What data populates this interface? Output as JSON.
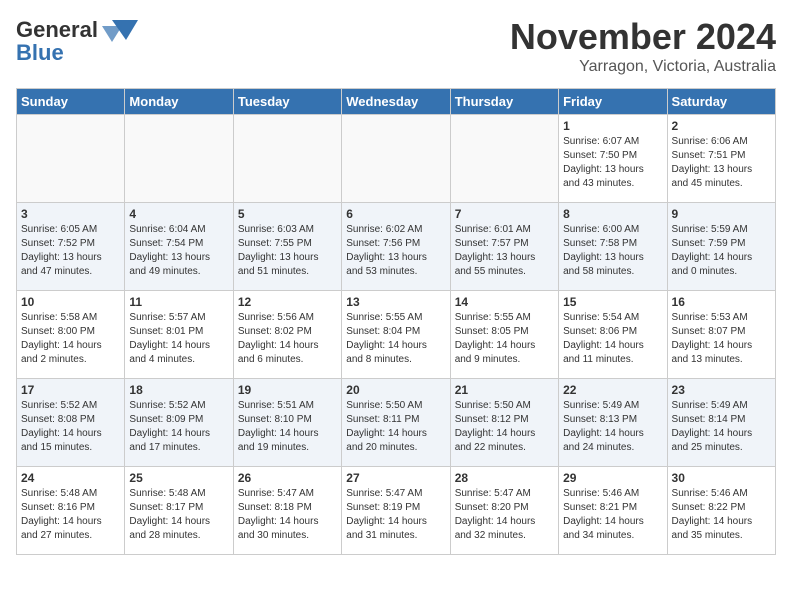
{
  "header": {
    "logo_line1": "General",
    "logo_line2": "Blue",
    "month_title": "November 2024",
    "subtitle": "Yarragon, Victoria, Australia"
  },
  "days_of_week": [
    "Sunday",
    "Monday",
    "Tuesday",
    "Wednesday",
    "Thursday",
    "Friday",
    "Saturday"
  ],
  "weeks": [
    [
      {
        "day": "",
        "empty": true
      },
      {
        "day": "",
        "empty": true
      },
      {
        "day": "",
        "empty": true
      },
      {
        "day": "",
        "empty": true
      },
      {
        "day": "",
        "empty": true
      },
      {
        "day": "1",
        "sunrise": "6:07 AM",
        "sunset": "7:50 PM",
        "daylight": "13 hours and 43 minutes."
      },
      {
        "day": "2",
        "sunrise": "6:06 AM",
        "sunset": "7:51 PM",
        "daylight": "13 hours and 45 minutes."
      }
    ],
    [
      {
        "day": "3",
        "sunrise": "6:05 AM",
        "sunset": "7:52 PM",
        "daylight": "13 hours and 47 minutes."
      },
      {
        "day": "4",
        "sunrise": "6:04 AM",
        "sunset": "7:54 PM",
        "daylight": "13 hours and 49 minutes."
      },
      {
        "day": "5",
        "sunrise": "6:03 AM",
        "sunset": "7:55 PM",
        "daylight": "13 hours and 51 minutes."
      },
      {
        "day": "6",
        "sunrise": "6:02 AM",
        "sunset": "7:56 PM",
        "daylight": "13 hours and 53 minutes."
      },
      {
        "day": "7",
        "sunrise": "6:01 AM",
        "sunset": "7:57 PM",
        "daylight": "13 hours and 55 minutes."
      },
      {
        "day": "8",
        "sunrise": "6:00 AM",
        "sunset": "7:58 PM",
        "daylight": "13 hours and 58 minutes."
      },
      {
        "day": "9",
        "sunrise": "5:59 AM",
        "sunset": "7:59 PM",
        "daylight": "14 hours and 0 minutes."
      }
    ],
    [
      {
        "day": "10",
        "sunrise": "5:58 AM",
        "sunset": "8:00 PM",
        "daylight": "14 hours and 2 minutes."
      },
      {
        "day": "11",
        "sunrise": "5:57 AM",
        "sunset": "8:01 PM",
        "daylight": "14 hours and 4 minutes."
      },
      {
        "day": "12",
        "sunrise": "5:56 AM",
        "sunset": "8:02 PM",
        "daylight": "14 hours and 6 minutes."
      },
      {
        "day": "13",
        "sunrise": "5:55 AM",
        "sunset": "8:04 PM",
        "daylight": "14 hours and 8 minutes."
      },
      {
        "day": "14",
        "sunrise": "5:55 AM",
        "sunset": "8:05 PM",
        "daylight": "14 hours and 9 minutes."
      },
      {
        "day": "15",
        "sunrise": "5:54 AM",
        "sunset": "8:06 PM",
        "daylight": "14 hours and 11 minutes."
      },
      {
        "day": "16",
        "sunrise": "5:53 AM",
        "sunset": "8:07 PM",
        "daylight": "14 hours and 13 minutes."
      }
    ],
    [
      {
        "day": "17",
        "sunrise": "5:52 AM",
        "sunset": "8:08 PM",
        "daylight": "14 hours and 15 minutes."
      },
      {
        "day": "18",
        "sunrise": "5:52 AM",
        "sunset": "8:09 PM",
        "daylight": "14 hours and 17 minutes."
      },
      {
        "day": "19",
        "sunrise": "5:51 AM",
        "sunset": "8:10 PM",
        "daylight": "14 hours and 19 minutes."
      },
      {
        "day": "20",
        "sunrise": "5:50 AM",
        "sunset": "8:11 PM",
        "daylight": "14 hours and 20 minutes."
      },
      {
        "day": "21",
        "sunrise": "5:50 AM",
        "sunset": "8:12 PM",
        "daylight": "14 hours and 22 minutes."
      },
      {
        "day": "22",
        "sunrise": "5:49 AM",
        "sunset": "8:13 PM",
        "daylight": "14 hours and 24 minutes."
      },
      {
        "day": "23",
        "sunrise": "5:49 AM",
        "sunset": "8:14 PM",
        "daylight": "14 hours and 25 minutes."
      }
    ],
    [
      {
        "day": "24",
        "sunrise": "5:48 AM",
        "sunset": "8:16 PM",
        "daylight": "14 hours and 27 minutes."
      },
      {
        "day": "25",
        "sunrise": "5:48 AM",
        "sunset": "8:17 PM",
        "daylight": "14 hours and 28 minutes."
      },
      {
        "day": "26",
        "sunrise": "5:47 AM",
        "sunset": "8:18 PM",
        "daylight": "14 hours and 30 minutes."
      },
      {
        "day": "27",
        "sunrise": "5:47 AM",
        "sunset": "8:19 PM",
        "daylight": "14 hours and 31 minutes."
      },
      {
        "day": "28",
        "sunrise": "5:47 AM",
        "sunset": "8:20 PM",
        "daylight": "14 hours and 32 minutes."
      },
      {
        "day": "29",
        "sunrise": "5:46 AM",
        "sunset": "8:21 PM",
        "daylight": "14 hours and 34 minutes."
      },
      {
        "day": "30",
        "sunrise": "5:46 AM",
        "sunset": "8:22 PM",
        "daylight": "14 hours and 35 minutes."
      }
    ]
  ]
}
